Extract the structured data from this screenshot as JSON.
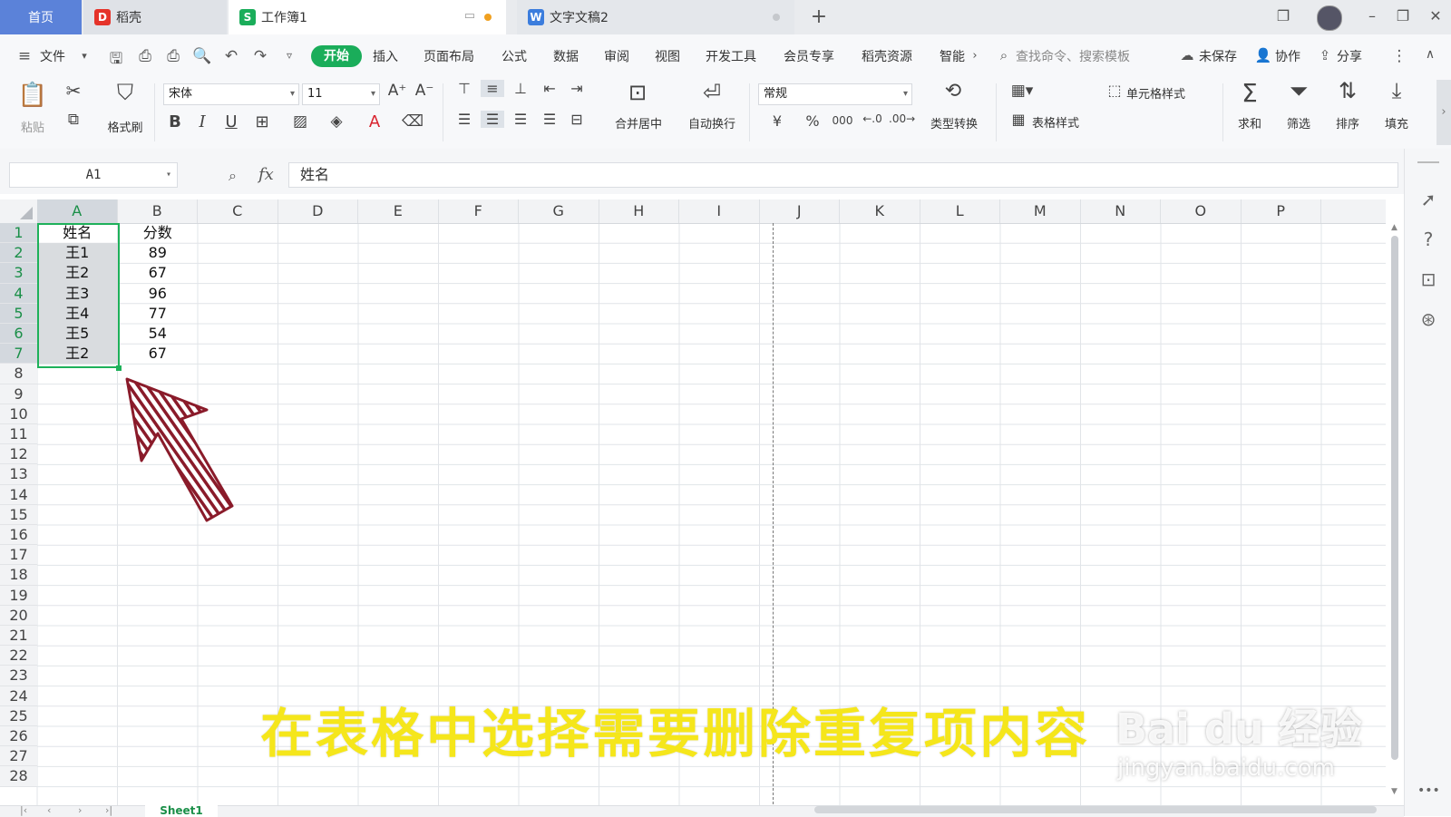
{
  "tabs": {
    "home": "首页",
    "daoke": "稻壳",
    "workbook": "工作簿1",
    "document": "文字文稿2",
    "add": "+"
  },
  "menu": {
    "file": "文件",
    "items": [
      "开始",
      "插入",
      "页面布局",
      "公式",
      "数据",
      "审阅",
      "视图",
      "开发工具",
      "会员专享",
      "稻壳资源",
      "智能"
    ],
    "search_placeholder": "查找命令、搜索模板",
    "unsaved": "未保存",
    "collab": "协作",
    "share": "分享"
  },
  "ribbon": {
    "paste": "粘贴",
    "format_painter": "格式刷",
    "font_name": "宋体",
    "font_size": "11",
    "merge_center": "合并居中",
    "wrap_text": "自动换行",
    "number_format": "常规",
    "type_convert": "类型转换",
    "cell_style": "单元格样式",
    "table_style": "表格样式",
    "sum": "求和",
    "filter": "筛选",
    "sort": "排序",
    "fill": "填充",
    "currency_symbol": "¥",
    "percent_symbol": "%",
    "thousands_symbol": "000"
  },
  "formula_bar": {
    "cell_ref": "A1",
    "fx": "fx",
    "content": "姓名"
  },
  "sheet": {
    "columns": [
      "A",
      "B",
      "C",
      "D",
      "E",
      "F",
      "G",
      "H",
      "I",
      "J",
      "K",
      "L",
      "M",
      "N",
      "O",
      "P"
    ],
    "visible_rows": [
      "1",
      "2",
      "3",
      "4",
      "5",
      "6",
      "7",
      "8",
      "9",
      "10",
      "11",
      "12",
      "13",
      "14",
      "15",
      "16",
      "17",
      "18",
      "19",
      "20",
      "21",
      "22",
      "23",
      "24",
      "25",
      "26",
      "27",
      "28"
    ],
    "data": [
      [
        "姓名",
        "分数"
      ],
      [
        "王1",
        "89"
      ],
      [
        "王2",
        "67"
      ],
      [
        "王3",
        "96"
      ],
      [
        "王4",
        "77"
      ],
      [
        "王5",
        "54"
      ],
      [
        "王2",
        "67"
      ]
    ],
    "selected_range": "A1:A7",
    "active_tab": "Sheet1"
  },
  "caption": "在表格中选择需要删除重复项内容",
  "watermark": {
    "main": "Bai du 经验",
    "sub": "jingyan.baidu.com"
  },
  "colors": {
    "accent_green": "#1eb15a",
    "home_tab": "#5b82d9",
    "caption_yellow": "#f5e61b",
    "arrow_red": "#8a1b2a"
  }
}
